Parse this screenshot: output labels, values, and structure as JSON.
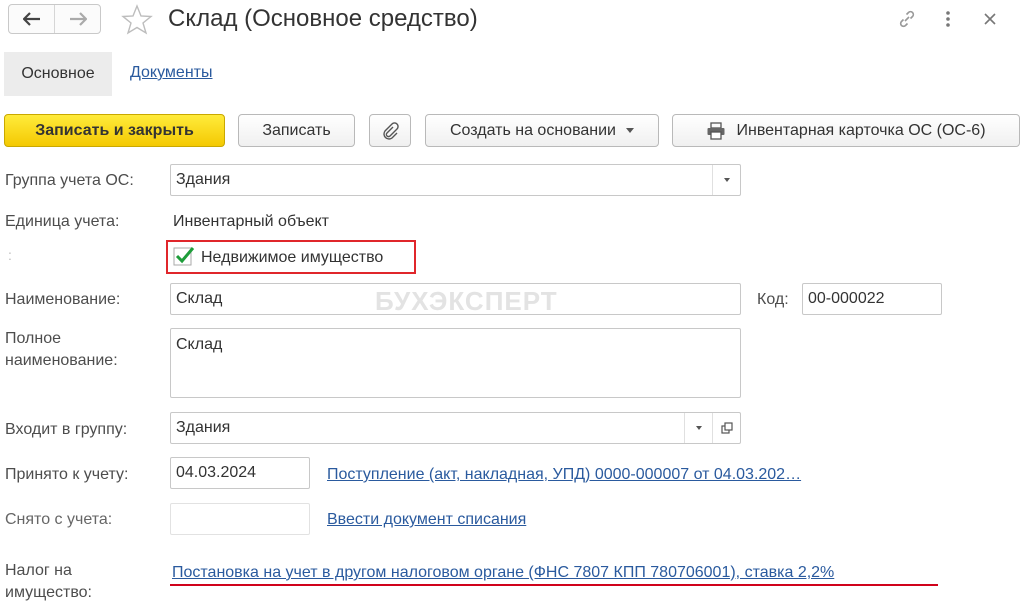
{
  "header": {
    "title": "Склад (Основное средство)",
    "back_icon": "arrow-left",
    "forward_icon": "arrow-right",
    "favorite_icon": "star-outline",
    "link_icon": "link",
    "menu_icon": "more-vertical",
    "close_icon": "close"
  },
  "tabs": [
    {
      "label": "Основное"
    },
    {
      "label": "Документы"
    }
  ],
  "toolbar": {
    "save_close_label": "Записать и закрыть",
    "save_label": "Записать",
    "attach_icon": "paperclip",
    "create_based_label": "Создать на основании",
    "print_label": "Инвентарная карточка ОС (ОС-6)",
    "print_icon": "printer"
  },
  "form": {
    "group_label": "Группа учета ОС:",
    "group_value": "Здания",
    "unit_label": "Единица учета:",
    "unit_value": "Инвентарный объект",
    "real_estate_label": "Недвижимое имущество",
    "real_estate_checked": true,
    "name_label": "Наименование:",
    "name_value": "Склад",
    "code_label": "Код:",
    "code_value": "00-000022",
    "fullname_label_1": "Полное",
    "fullname_label_2": "наименование:",
    "fullname_value": "Склад",
    "parent_label": "Входит в группу:",
    "parent_value": "Здания",
    "accepted_label": "Принято к учету:",
    "accepted_date": "04.03.2024",
    "accepted_doc_link": "Поступление (акт, накладная, УПД) 0000-000007 от 04.03.202…",
    "removed_label": "Снято с учета:",
    "removed_date": "",
    "removed_link": "Ввести документ списания",
    "tax_label_1": "Налог на",
    "tax_label_2": "имущество:",
    "tax_link": "Постановка на учет в другом налоговом органе (ФНС 7807 КПП 780706001), ставка 2,2%"
  },
  "watermark": "БУХЭКСПЕРТ",
  "colors": {
    "primary_button": "#f4c902",
    "link": "#2a5a9e",
    "highlight_red": "#e0262b",
    "checkmark": "#1e9d3a"
  }
}
